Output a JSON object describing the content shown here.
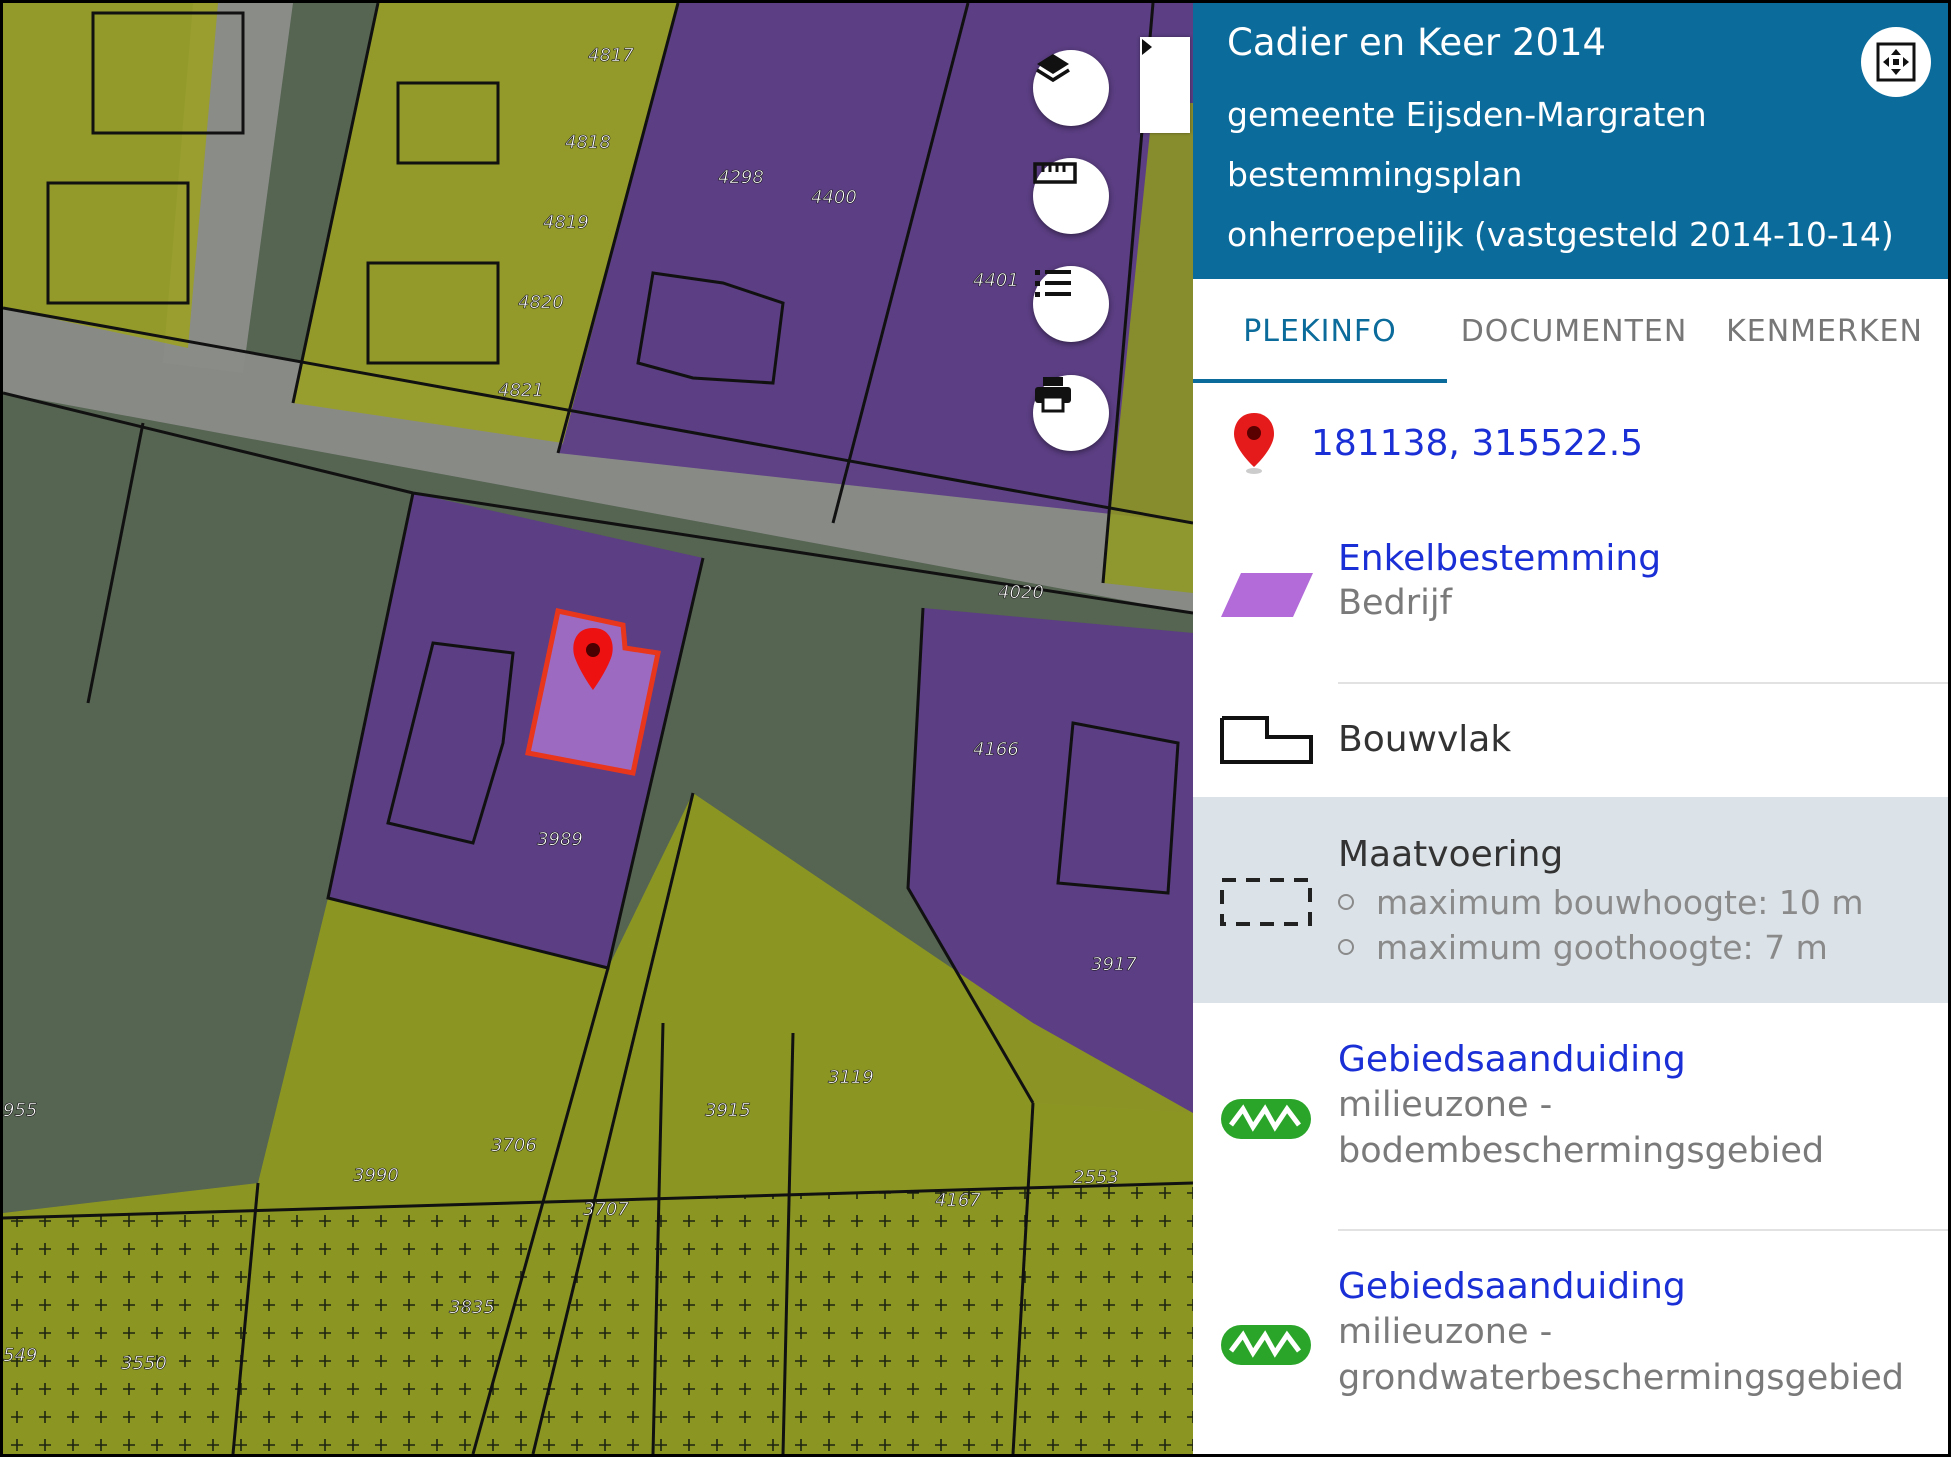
{
  "header": {
    "title": "Cadier en Keer 2014",
    "municipality": "gemeente Eijsden-Margraten",
    "plan_type": "bestemmingsplan",
    "status": "onherroepelijk (vastgesteld 2014-10-14)"
  },
  "tabs": [
    {
      "label": "PLEKINFO",
      "active": true
    },
    {
      "label": "DOCUMENTEN",
      "active": false
    },
    {
      "label": "KENMERKEN",
      "active": false
    }
  ],
  "location": {
    "coordinates": "181138, 315522.5",
    "icon": "map-pin-icon"
  },
  "items": {
    "enkelbestemming": {
      "title": "Enkelbestemming",
      "value": "Bedrijf",
      "icon": "purple-parallelogram-icon",
      "color": "#b26bd9"
    },
    "bouwvlak": {
      "title": "Bouwvlak",
      "icon": "building-outline-icon"
    },
    "maatvoering": {
      "title": "Maatvoering",
      "icon": "dashed-rectangle-icon",
      "bullets": [
        "maximum bouwhoogte: 10 m",
        "maximum goothoogte: 7 m"
      ]
    },
    "gebied1": {
      "title": "Gebiedsaanduiding",
      "value_line1": "milieuzone -",
      "value_line2": "bodembeschermingsgebied",
      "icon": "green-zigzag-icon"
    },
    "gebied2": {
      "title": "Gebiedsaanduiding",
      "value_line1": "milieuzone -",
      "value_line2": "grondwaterbeschermingsgebied",
      "icon": "green-zigzag-icon"
    }
  },
  "map": {
    "parcel_labels": [
      "4817",
      "4818",
      "4819",
      "4820",
      "4821",
      "4298",
      "4400",
      "4401",
      "4020",
      "4166",
      "3989",
      "3917",
      "3119",
      "3915",
      "3706",
      "3990",
      "3707",
      "4167",
      "2553",
      "3835",
      "3550",
      "955",
      "549"
    ],
    "buttons": [
      "layers-icon",
      "ruler-icon",
      "legend-list-icon",
      "print-icon"
    ]
  },
  "colors": {
    "header_bg": "#0b6b9a",
    "tab_active": "#0b6b9a",
    "link": "#1a2fd6",
    "bedrijf_purple": "#5b3b86",
    "agrarisch_olive": "#8f9a1e",
    "selection_red": "#e8361c"
  }
}
